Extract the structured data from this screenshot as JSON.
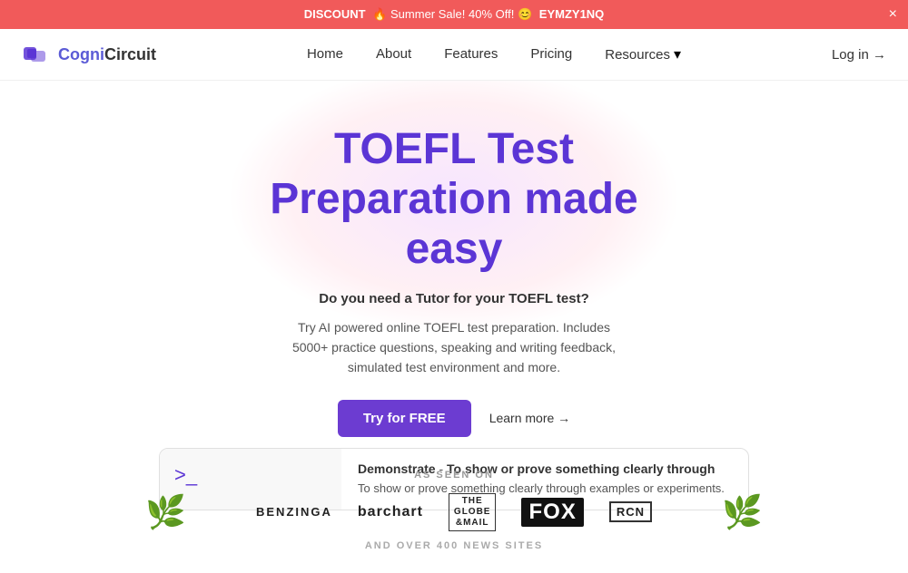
{
  "announcement": {
    "prefix": "DISCOUNT",
    "emoji_fire": "🔥",
    "message": "Summer Sale! 40% Off!",
    "emoji_face": "😊",
    "coupon": "EYMZY1NQ",
    "close_label": "×"
  },
  "nav": {
    "logo_text_cogni": "Cogni",
    "logo_text_circuit": "Circuit",
    "links": [
      {
        "label": "Home"
      },
      {
        "label": "About"
      },
      {
        "label": "Features"
      },
      {
        "label": "Pricing"
      },
      {
        "label": "Resources"
      }
    ],
    "login_label": "Log in →"
  },
  "hero": {
    "title_line1": "TOEFL Test",
    "title_line2": "Preparation made",
    "title_line3": "easy",
    "subtitle": "Do you need a Tutor for your TOEFL test?",
    "description": "Try AI powered online TOEFL test preparation. Includes 5000+ practice questions, speaking and writing feedback, simulated test environment and more.",
    "try_btn": "Try for FREE",
    "learn_more": "Learn more →"
  },
  "as_seen_on": {
    "label": "AS SEEN ON",
    "logos": [
      {
        "name": "BENZINGA",
        "class": "benzinga"
      },
      {
        "name": "barchart",
        "class": "barchart"
      },
      {
        "name": "THE\nGLOBE\nMAIL",
        "class": "globemail"
      },
      {
        "name": "FOX",
        "class": "fox"
      },
      {
        "name": "RCN",
        "class": "rsn"
      }
    ],
    "extra": "AND OVER 400 NEWS SITES"
  },
  "bottom_preview": {
    "terminal_prompt": ">_",
    "definition_word": "Demonstrate",
    "definition_dash": " - ",
    "definition_text": "To show or prove something clearly through examples or experiments."
  }
}
